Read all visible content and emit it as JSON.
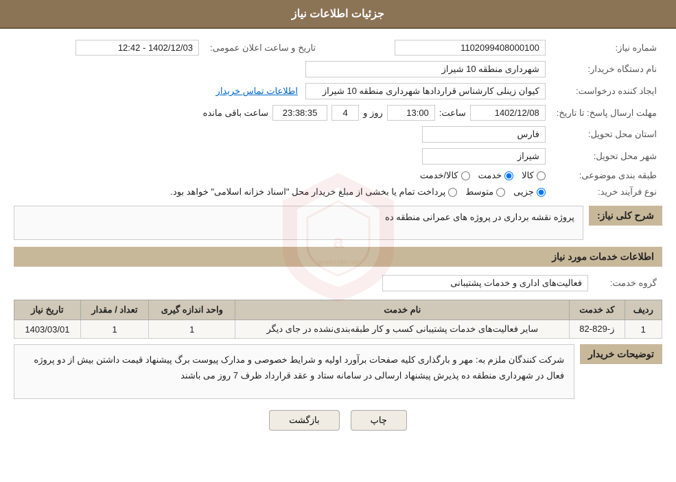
{
  "header": {
    "title": "جزئیات اطلاعات نیاز"
  },
  "fields": {
    "need_number_label": "شماره نیاز:",
    "need_number_value": "1102099408000100",
    "buyer_org_label": "نام دستگاه خریدار:",
    "buyer_org_value": "شهرداری منطقه 10 شیراز",
    "creator_label": "ایجاد کننده درخواست:",
    "creator_value": "کیوان زینلی کارشناس قراردادها شهرداری منطقه 10 شیراز",
    "creator_link": "اطلاعات تماس خریدار",
    "deadline_label": "مهلت ارسال پاسخ: تا تاریخ:",
    "deadline_date": "1402/12/08",
    "deadline_time_label": "ساعت:",
    "deadline_time": "13:00",
    "deadline_days_label": "روز و",
    "deadline_days": "4",
    "countdown_label": "ساعت باقی مانده",
    "countdown_value": "23:38:35",
    "announce_label": "تاریخ و ساعت اعلان عمومی:",
    "announce_value": "1402/12/03 - 12:42",
    "province_label": "استان محل تحویل:",
    "province_value": "فارس",
    "city_label": "شهر محل تحویل:",
    "city_value": "شیراز",
    "category_label": "طبقه بندی موضوعی:",
    "category_options": [
      "کالا",
      "خدمت",
      "کالا/خدمت"
    ],
    "category_selected": "خدمت",
    "purchase_type_label": "نوع فرآیند خرید:",
    "purchase_type_options": [
      "جزیی",
      "متوسط",
      "پرداخت تمام یا بخشی از مبلغ خریدار محل \"اسناد خزانه اسلامی\" خواهد بود."
    ],
    "purchase_type_selected": "جزیی"
  },
  "general_description": {
    "title": "شرح کلی نیاز:",
    "value": "پروژه نقشه برداری در پروژه های عمرانی منطقه ده"
  },
  "services_section": {
    "title": "اطلاعات خدمات مورد نیاز",
    "service_group_label": "گروه خدمت:",
    "service_group_value": "فعالیت‌های اداری و خدمات پشتیبانی",
    "table_headers": [
      "ردیف",
      "کد خدمت",
      "نام خدمت",
      "واحد اندازه گیری",
      "تعداد / مقدار",
      "تاریخ نیاز"
    ],
    "table_rows": [
      {
        "row": "1",
        "code": "ز-829-82",
        "name": "سایر فعالیت‌های خدمات پشتیبانی کسب و کار طبقه‌بندی‌نشده در جای دیگر",
        "unit": "1",
        "qty": "1",
        "date": "1403/03/01"
      }
    ]
  },
  "buyer_notes": {
    "title": "توضیحات خریدار",
    "value": "شرکت کنندگان ملزم به:\nمهر و بارگذاری کلیه صفحات برآورد اولیه و شرایط خصوصی و مدارک پیوست برگ پیشنهاد قیمت\nداشتن بیش از دو پروژه فعال در شهرداری منطقه ده\nپذیرش پیشنهاد ارسالی در سامانه ستاد و عقد قرارداد ظرف 7 روز می باشند"
  },
  "buttons": {
    "print_label": "چاپ",
    "back_label": "بازگشت"
  }
}
